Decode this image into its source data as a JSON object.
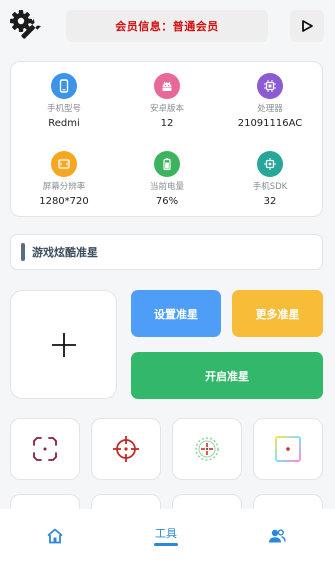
{
  "header": {
    "member_text": "会员信息：普通会员",
    "settings_icon": "gear-wrench-icon",
    "play_icon": "play-icon"
  },
  "device_info": [
    {
      "label": "手机型号",
      "value": "Redmi",
      "icon": "phone-icon",
      "color": "#3d93e8"
    },
    {
      "label": "安卓版本",
      "value": "12",
      "icon": "android-icon",
      "color": "#e8689a"
    },
    {
      "label": "处理器",
      "value": "21091116AC",
      "icon": "cpu-icon",
      "color": "#8a5bd3"
    },
    {
      "label": "屏幕分辨率",
      "value": "1280*720",
      "icon": "screen-icon",
      "color": "#f5a623"
    },
    {
      "label": "当前电量",
      "value": "76%",
      "icon": "battery-icon",
      "color": "#3db35d"
    },
    {
      "label": "手机SDK",
      "value": "32",
      "icon": "sdk-chip-icon",
      "color": "#27a79a"
    }
  ],
  "section": {
    "title": "游戏炫酷准星"
  },
  "actions": {
    "set_label": "设置准星",
    "more_label": "更多准星",
    "start_label": "开启准星"
  },
  "colors": {
    "set": "#4e9ef8",
    "more": "#f7bd38",
    "start": "#33b76a",
    "accent": "#2b88d8",
    "member_text": "#d10e0e"
  },
  "nav": {
    "items": [
      {
        "label": "",
        "icon": "home-icon"
      },
      {
        "label": "工具",
        "icon": "tools",
        "active": true
      },
      {
        "label": "",
        "icon": "users-icon"
      }
    ]
  }
}
